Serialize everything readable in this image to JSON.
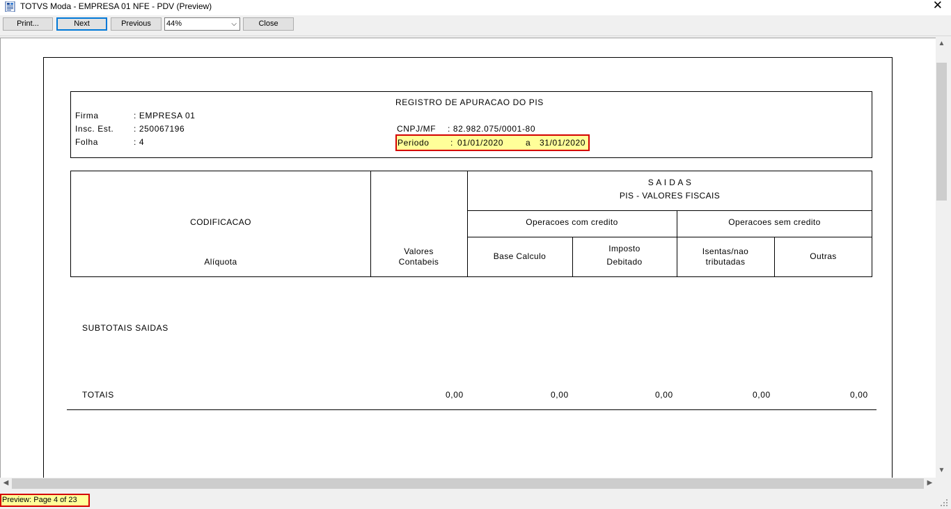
{
  "window": {
    "title": "TOTVS Moda - EMPRESA 01 NFE - PDV (Preview)",
    "close_glyph": "✕"
  },
  "toolbar": {
    "print_label": "Print...",
    "next_label": "Next",
    "previous_label": "Previous",
    "zoom_value": "44%",
    "close_label": "Close"
  },
  "report": {
    "title": "REGISTRO DE APURACAO DO PIS",
    "firma_label": "Firma",
    "firma_value": ":  EMPRESA 01",
    "insc_label": "Insc. Est.",
    "insc_value": ":  250067196",
    "folha_label": "Folha",
    "folha_value": ":  4",
    "cnpj_label": "CNPJ/MF",
    "cnpj_value": ":  82.982.075/0001-80",
    "periodo_label": "Periodo",
    "periodo_sep": ":",
    "periodo_from": "01/01/2020",
    "periodo_a": "a",
    "periodo_to": "31/01/2020",
    "table": {
      "codificacao": "CODIFICACAO",
      "aliquota": "Alíquota",
      "valores_1": "Valores",
      "valores_2": "Contabeis",
      "saidas": "S A I D A S",
      "pis_valores": "PIS - VALORES FISCAIS",
      "com_credito": "Operacoes com credito",
      "sem_credito": "Operacoes sem credito",
      "base_calculo": "Base Calculo",
      "imposto_1": "Imposto",
      "imposto_2": "Debitado",
      "isentas_1": "Isentas/nao",
      "isentas_2": "tributadas",
      "outras": "Outras"
    },
    "subtotais": "SUBTOTAIS SAIDAS",
    "totais_label": "TOTAIS",
    "totais_values": [
      "0,00",
      "0,00",
      "0,00",
      "0,00",
      "0,00"
    ]
  },
  "status": {
    "text": "Preview: Page 4 of 23"
  },
  "colors": {
    "highlight_fill": "#ffff99",
    "highlight_border": "#d40000",
    "focus_blue": "#0078d7"
  },
  "icons": [
    "app-report-icon",
    "close-icon",
    "chevron-down-icon",
    "scroll-up-arrow-icon",
    "scroll-down-arrow-icon",
    "scroll-left-arrow-icon",
    "scroll-right-arrow-icon",
    "resize-grip-icon"
  ]
}
